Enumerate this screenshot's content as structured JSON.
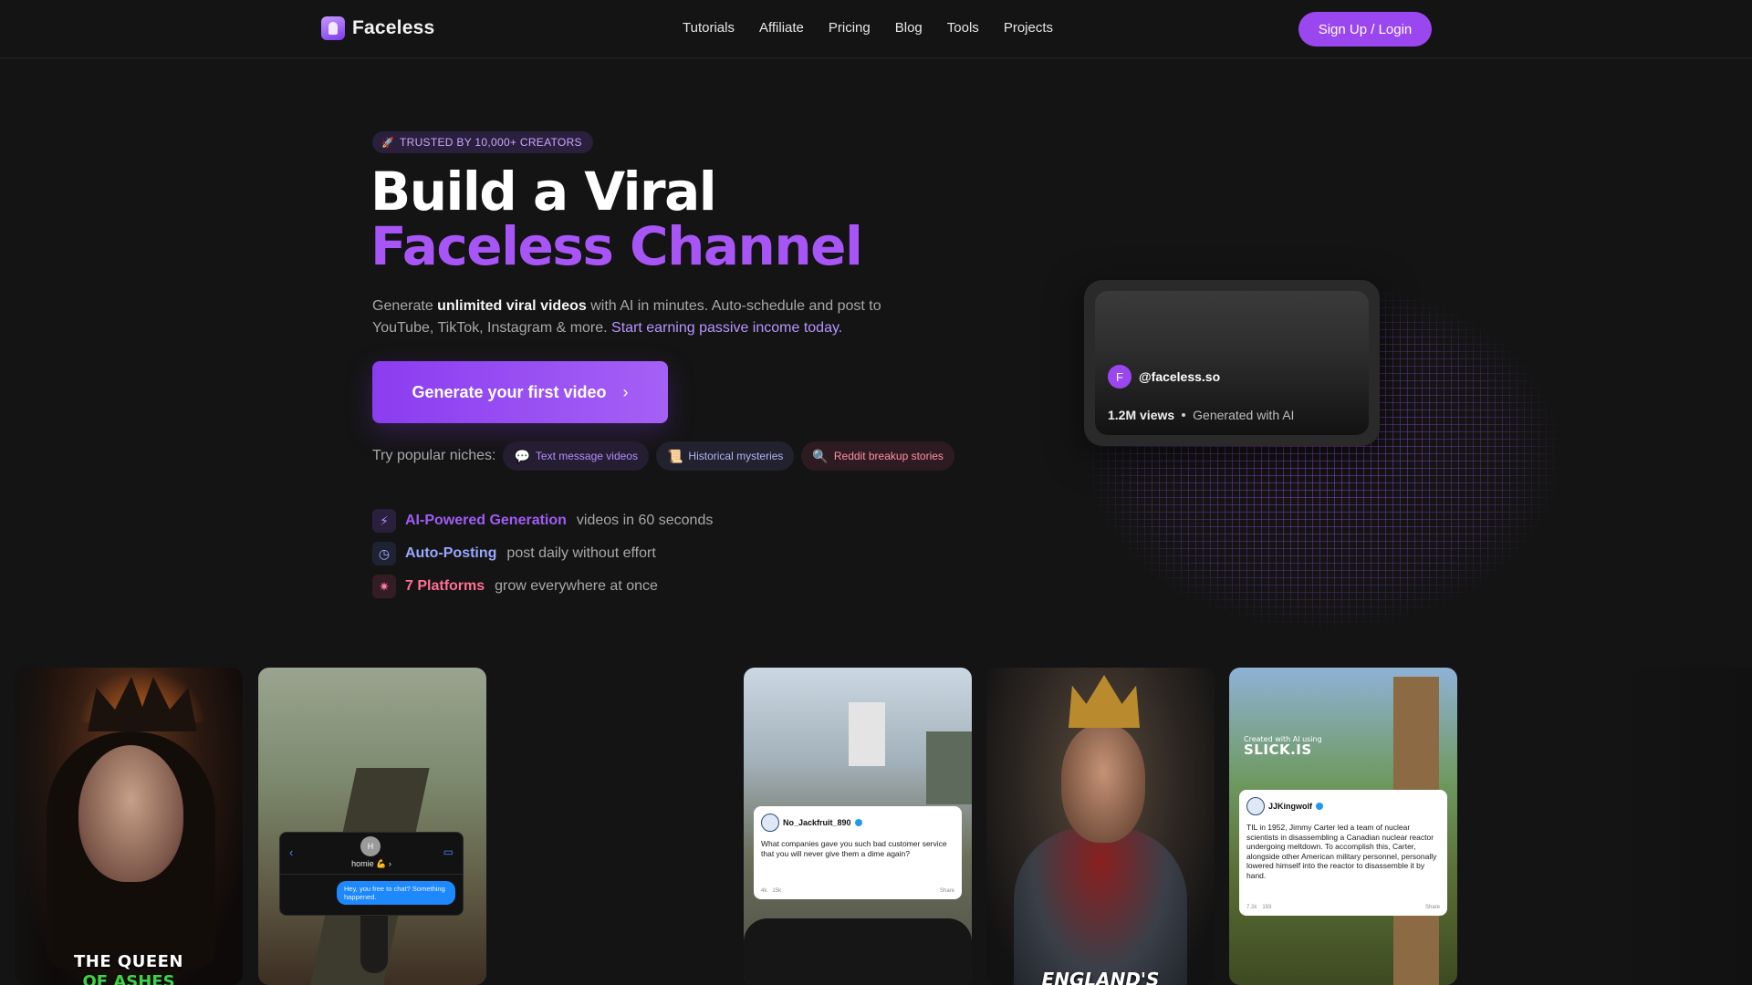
{
  "brand": {
    "name": "Faceless"
  },
  "nav": {
    "links": [
      "Tutorials",
      "Affiliate",
      "Pricing",
      "Blog",
      "Tools",
      "Projects"
    ],
    "signup_label": "Sign Up / Login"
  },
  "hero": {
    "badge": "TRUSTED BY 10,000+ CREATORS",
    "title_line1": "Build a Viral",
    "title_line2": "Faceless Channel",
    "desc": {
      "p1": "Generate ",
      "bold": "unlimited viral videos",
      "p2": " with AI in minutes. Auto-schedule and post to YouTube, TikTok, Instagram & more. ",
      "highlight": "Start earning passive income today."
    },
    "cta_label": "Generate your first video",
    "niches_label": "Try popular niches:",
    "niches": [
      "Text message videos",
      "Historical mysteries",
      "Reddit breakup stories"
    ],
    "features": [
      {
        "title": "AI-Powered Generation",
        "sub": "videos in 60 seconds",
        "icon": "lightning-icon"
      },
      {
        "title": "Auto-Posting",
        "sub": "post daily without effort",
        "icon": "clock-icon"
      },
      {
        "title": "7 Platforms",
        "sub": "grow everywhere at once",
        "icon": "sparkle-icon"
      }
    ]
  },
  "preview": {
    "avatar_letter": "F",
    "handle": "@faceless.so",
    "views": "1.2M views",
    "generated": "Generated with AI"
  },
  "cards": {
    "queen_title": "THE QUEEN",
    "queen_sub": "OF ASHES",
    "chat_avatar": "H",
    "chat_name": "homie 💪 ›",
    "chat_message": "Hey, you free to chat? Something happened.",
    "tweet1": {
      "user": "No_Jackfruit_890",
      "body": "What companies gave you such bad customer service that you will never give them a dime again?",
      "likes": "4k",
      "comments": "15k",
      "share": "Share"
    },
    "king_title": "ENGLAND'S",
    "slick_small": "Created with AI using",
    "slick_big": "SLICK.IS",
    "tweet2": {
      "user": "JJKingwolf",
      "body": "TIL in 1952, Jimmy Carter led a team of nuclear scientists in disassembling a Canadian nuclear reactor undergoing meltdown. To accomplish this, Carter, alongside other American military personnel, personally lowered himself into the reactor to disassemble it by hand.",
      "likes": "7.2k",
      "comments": "193",
      "share": "Share"
    }
  },
  "colors": {
    "accent": "#a855f7",
    "background": "#141414",
    "blue_accent": "#9aa6ff",
    "pink_accent": "#ff6e93"
  }
}
